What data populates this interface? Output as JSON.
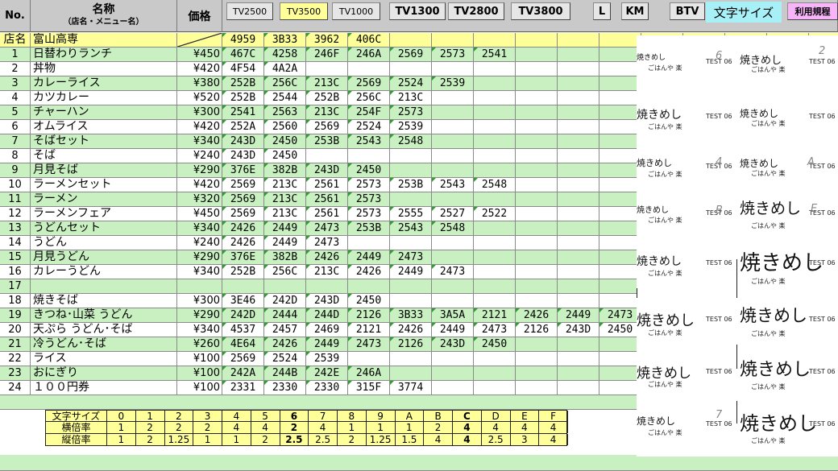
{
  "header": {
    "no": "No.",
    "name": "名称",
    "name_sub": "（店名・メニュー名）",
    "price": "価格"
  },
  "toolbar": {
    "tv2500": "TV2500",
    "tv3500": "TV3500",
    "tv1000": "TV1000",
    "tv1300": "TV1300",
    "tv2800": "TV2800",
    "tv3800": "TV3800",
    "l": "L",
    "km": "KM",
    "btv": "BTV",
    "font_size": "文字サイズ",
    "terms": "利用規程"
  },
  "store_row": {
    "label": "店名",
    "name": "富山高専",
    "codes": [
      "4959",
      "3B33",
      "3962",
      "406C"
    ]
  },
  "rows": [
    {
      "no": "1",
      "name": "日替わりランチ",
      "price": "¥450",
      "codes": [
        "467C",
        "4258",
        "246F",
        "246A",
        "2569",
        "2573",
        "2541"
      ]
    },
    {
      "no": "2",
      "name": "丼物",
      "price": "¥420",
      "codes": [
        "4F54",
        "4A2A"
      ]
    },
    {
      "no": "3",
      "name": "カレーライス",
      "price": "¥380",
      "codes": [
        "252B",
        "256C",
        "213C",
        "2569",
        "2524",
        "2539"
      ]
    },
    {
      "no": "4",
      "name": "カツカレー",
      "price": "¥520",
      "codes": [
        "252B",
        "2544",
        "252B",
        "256C",
        "213C"
      ]
    },
    {
      "no": "5",
      "name": "チャーハン",
      "price": "¥300",
      "codes": [
        "2541",
        "2563",
        "213C",
        "254F",
        "2573"
      ]
    },
    {
      "no": "6",
      "name": "オムライス",
      "price": "¥420",
      "codes": [
        "252A",
        "2560",
        "2569",
        "2524",
        "2539"
      ]
    },
    {
      "no": "7",
      "name": "そばセット",
      "price": "¥340",
      "codes": [
        "243D",
        "2450",
        "253B",
        "2543",
        "2548"
      ]
    },
    {
      "no": "8",
      "name": "そば",
      "price": "¥240",
      "codes": [
        "243D",
        "2450"
      ]
    },
    {
      "no": "9",
      "name": "月見そば",
      "price": "¥290",
      "codes": [
        "376E",
        "382B",
        "243D",
        "2450"
      ]
    },
    {
      "no": "10",
      "name": "ラーメンセット",
      "price": "¥420",
      "codes": [
        "2569",
        "213C",
        "2561",
        "2573",
        "253B",
        "2543",
        "2548"
      ]
    },
    {
      "no": "11",
      "name": "ラーメン",
      "price": "¥320",
      "codes": [
        "2569",
        "213C",
        "2561",
        "2573"
      ]
    },
    {
      "no": "12",
      "name": "ラーメンフェア",
      "price": "¥450",
      "codes": [
        "2569",
        "213C",
        "2561",
        "2573",
        "2555",
        "2527",
        "2522"
      ]
    },
    {
      "no": "13",
      "name": "うどんセット",
      "price": "¥340",
      "codes": [
        "2426",
        "2449",
        "2473",
        "253B",
        "2543",
        "2548"
      ]
    },
    {
      "no": "14",
      "name": "うどん",
      "price": "¥240",
      "codes": [
        "2426",
        "2449",
        "2473"
      ]
    },
    {
      "no": "15",
      "name": "月見うどん",
      "price": "¥290",
      "codes": [
        "376E",
        "382B",
        "2426",
        "2449",
        "2473"
      ]
    },
    {
      "no": "16",
      "name": "カレーうどん",
      "price": "¥340",
      "codes": [
        "252B",
        "256C",
        "213C",
        "2426",
        "2449",
        "2473"
      ]
    },
    {
      "no": "17",
      "name": "",
      "price": "",
      "codes": []
    },
    {
      "no": "18",
      "name": "焼きそば",
      "price": "¥300",
      "codes": [
        "3E46",
        "242D",
        "243D",
        "2450"
      ]
    },
    {
      "no": "19",
      "name": "きつね･山菜 うどん",
      "price": "¥290",
      "codes": [
        "242D",
        "2444",
        "244D",
        "2126",
        "3B33",
        "3A5A",
        "2121",
        "2426",
        "2449",
        "2473"
      ]
    },
    {
      "no": "20",
      "name": "天ぷら うどん･そば",
      "price": "¥340",
      "codes": [
        "4537",
        "2457",
        "2469",
        "2121",
        "2426",
        "2449",
        "2473",
        "2126",
        "243D",
        "2450"
      ]
    },
    {
      "no": "21",
      "name": "冷うどん･そば",
      "price": "¥260",
      "codes": [
        "4E64",
        "2426",
        "2449",
        "2473",
        "2126",
        "243D",
        "2450"
      ]
    },
    {
      "no": "22",
      "name": "ライス",
      "price": "¥100",
      "codes": [
        "2569",
        "2524",
        "2539"
      ]
    },
    {
      "no": "23",
      "name": "おにぎり",
      "price": "¥100",
      "codes": [
        "242A",
        "244B",
        "242E",
        "246A"
      ]
    },
    {
      "no": "24",
      "name": "１００円券",
      "price": "¥100",
      "codes": [
        "2331",
        "2330",
        "2330",
        "315F",
        "3774"
      ]
    }
  ],
  "legend": {
    "size_label": "文字サイズ",
    "h_label": "横倍率",
    "v_label": "縦倍率",
    "sizes": [
      "0",
      "1",
      "2",
      "3",
      "4",
      "5",
      "6",
      "7",
      "8",
      "9",
      "A",
      "B",
      "C",
      "D",
      "E",
      "F"
    ],
    "h_vals": [
      "1",
      "2",
      "2",
      "2",
      "4",
      "4",
      "2",
      "4",
      "1",
      "1",
      "1",
      "2",
      "4",
      "4",
      "4",
      "4"
    ],
    "v_vals": [
      "1",
      "2",
      "1.25",
      "1",
      "1",
      "2",
      "2.5",
      "2.5",
      "2",
      "1.25",
      "1.5",
      "4",
      "4",
      "2.5",
      "3",
      "4"
    ],
    "bold_cols": [
      6,
      12
    ]
  },
  "preview": {
    "item": "焼きめし",
    "sub": "ごはんや 楽",
    "test": "TEST 06",
    "numbers": [
      "6",
      "2",
      "4",
      "A",
      "B",
      "E",
      "7"
    ]
  }
}
